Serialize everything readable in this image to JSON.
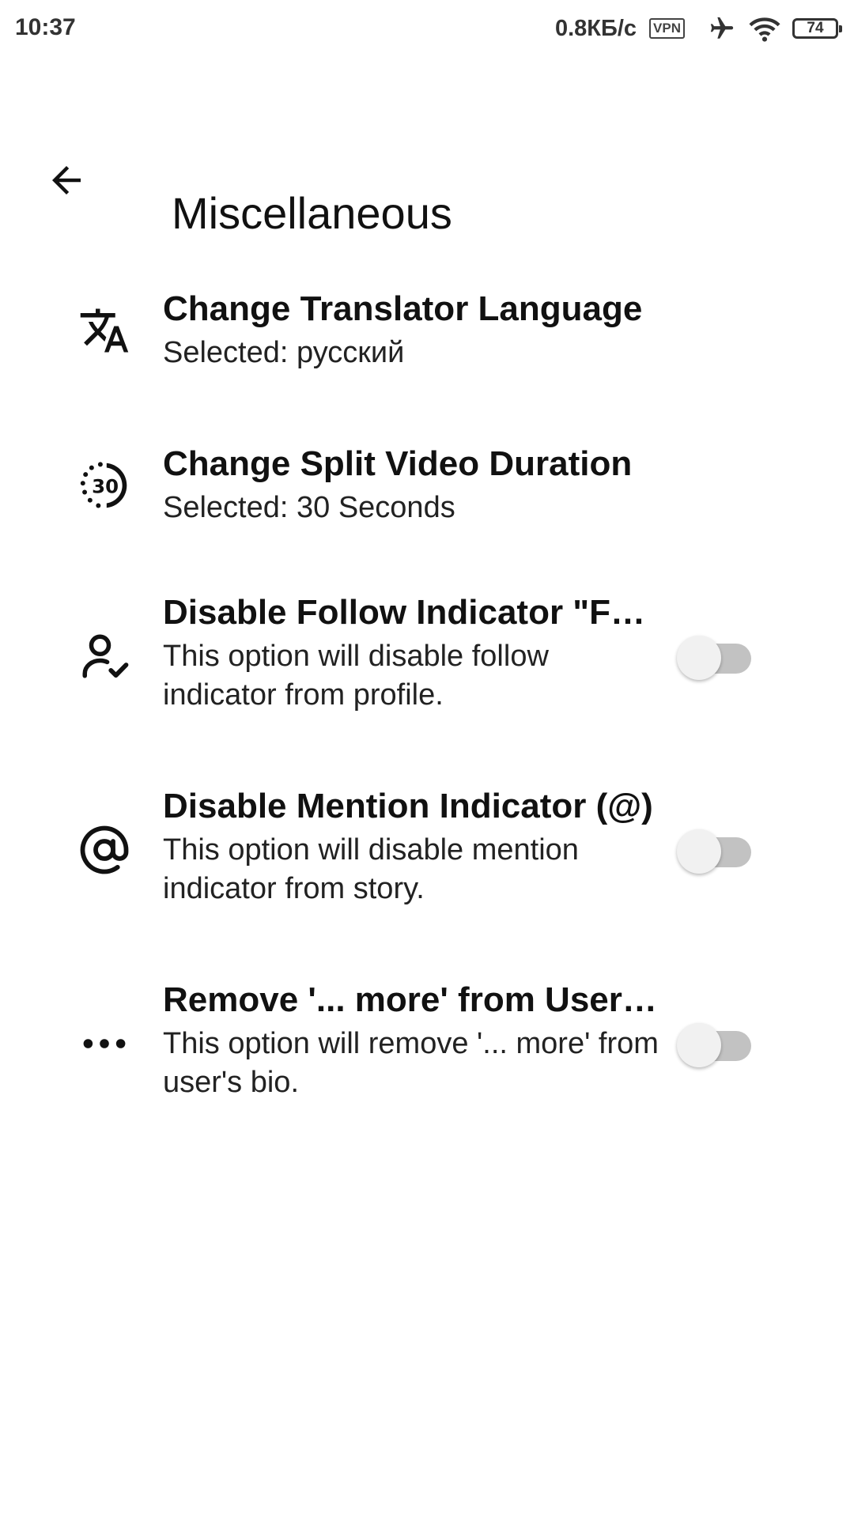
{
  "status_bar": {
    "time": "10:37",
    "network_speed": "0.8КБ/с",
    "vpn_label": "VPN",
    "battery_level": "74",
    "icons": [
      "airplane-icon",
      "wifi-icon",
      "battery-icon"
    ]
  },
  "app_bar": {
    "back_icon": "arrow-back-icon",
    "title": "Miscellaneous"
  },
  "settings": {
    "items": [
      {
        "icon": "translate-icon",
        "title": "Change Translator Language",
        "subtitle": "Selected: русский"
      },
      {
        "icon": "timer-30-icon",
        "title": "Change Split Video Duration",
        "subtitle": "Selected: 30 Seconds"
      },
      {
        "icon": "person-check-icon",
        "title": "Disable Follow Indicator \"Follows you\"",
        "subtitle": "This option will disable follow indicator from profile.",
        "toggle_on": false
      },
      {
        "icon": "at-sign-icon",
        "title": "Disable Mention Indicator (@)",
        "subtitle": "This option will disable mention indicator from story.",
        "toggle_on": false
      },
      {
        "icon": "more-horizontal-icon",
        "title": "Remove '... more' from User's bio",
        "subtitle": "This option will remove '... more' from user's bio.",
        "toggle_on": false
      }
    ]
  },
  "colors": {
    "background": "#ffffff",
    "text_primary": "#111111",
    "toggle_track_off": "#c2c2c2",
    "toggle_thumb_off": "#f1f1f1"
  }
}
